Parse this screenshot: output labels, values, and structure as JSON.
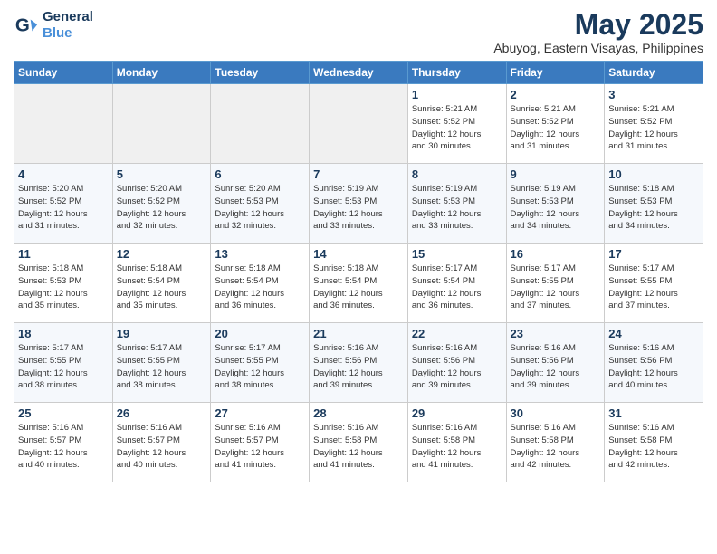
{
  "logo": {
    "line1": "General",
    "line2": "Blue"
  },
  "title": "May 2025",
  "subtitle": "Abuyog, Eastern Visayas, Philippines",
  "headers": [
    "Sunday",
    "Monday",
    "Tuesday",
    "Wednesday",
    "Thursday",
    "Friday",
    "Saturday"
  ],
  "weeks": [
    [
      {
        "day": "",
        "info": ""
      },
      {
        "day": "",
        "info": ""
      },
      {
        "day": "",
        "info": ""
      },
      {
        "day": "",
        "info": ""
      },
      {
        "day": "1",
        "info": "Sunrise: 5:21 AM\nSunset: 5:52 PM\nDaylight: 12 hours\nand 30 minutes."
      },
      {
        "day": "2",
        "info": "Sunrise: 5:21 AM\nSunset: 5:52 PM\nDaylight: 12 hours\nand 31 minutes."
      },
      {
        "day": "3",
        "info": "Sunrise: 5:21 AM\nSunset: 5:52 PM\nDaylight: 12 hours\nand 31 minutes."
      }
    ],
    [
      {
        "day": "4",
        "info": "Sunrise: 5:20 AM\nSunset: 5:52 PM\nDaylight: 12 hours\nand 31 minutes."
      },
      {
        "day": "5",
        "info": "Sunrise: 5:20 AM\nSunset: 5:52 PM\nDaylight: 12 hours\nand 32 minutes."
      },
      {
        "day": "6",
        "info": "Sunrise: 5:20 AM\nSunset: 5:53 PM\nDaylight: 12 hours\nand 32 minutes."
      },
      {
        "day": "7",
        "info": "Sunrise: 5:19 AM\nSunset: 5:53 PM\nDaylight: 12 hours\nand 33 minutes."
      },
      {
        "day": "8",
        "info": "Sunrise: 5:19 AM\nSunset: 5:53 PM\nDaylight: 12 hours\nand 33 minutes."
      },
      {
        "day": "9",
        "info": "Sunrise: 5:19 AM\nSunset: 5:53 PM\nDaylight: 12 hours\nand 34 minutes."
      },
      {
        "day": "10",
        "info": "Sunrise: 5:18 AM\nSunset: 5:53 PM\nDaylight: 12 hours\nand 34 minutes."
      }
    ],
    [
      {
        "day": "11",
        "info": "Sunrise: 5:18 AM\nSunset: 5:53 PM\nDaylight: 12 hours\nand 35 minutes."
      },
      {
        "day": "12",
        "info": "Sunrise: 5:18 AM\nSunset: 5:54 PM\nDaylight: 12 hours\nand 35 minutes."
      },
      {
        "day": "13",
        "info": "Sunrise: 5:18 AM\nSunset: 5:54 PM\nDaylight: 12 hours\nand 36 minutes."
      },
      {
        "day": "14",
        "info": "Sunrise: 5:18 AM\nSunset: 5:54 PM\nDaylight: 12 hours\nand 36 minutes."
      },
      {
        "day": "15",
        "info": "Sunrise: 5:17 AM\nSunset: 5:54 PM\nDaylight: 12 hours\nand 36 minutes."
      },
      {
        "day": "16",
        "info": "Sunrise: 5:17 AM\nSunset: 5:55 PM\nDaylight: 12 hours\nand 37 minutes."
      },
      {
        "day": "17",
        "info": "Sunrise: 5:17 AM\nSunset: 5:55 PM\nDaylight: 12 hours\nand 37 minutes."
      }
    ],
    [
      {
        "day": "18",
        "info": "Sunrise: 5:17 AM\nSunset: 5:55 PM\nDaylight: 12 hours\nand 38 minutes."
      },
      {
        "day": "19",
        "info": "Sunrise: 5:17 AM\nSunset: 5:55 PM\nDaylight: 12 hours\nand 38 minutes."
      },
      {
        "day": "20",
        "info": "Sunrise: 5:17 AM\nSunset: 5:55 PM\nDaylight: 12 hours\nand 38 minutes."
      },
      {
        "day": "21",
        "info": "Sunrise: 5:16 AM\nSunset: 5:56 PM\nDaylight: 12 hours\nand 39 minutes."
      },
      {
        "day": "22",
        "info": "Sunrise: 5:16 AM\nSunset: 5:56 PM\nDaylight: 12 hours\nand 39 minutes."
      },
      {
        "day": "23",
        "info": "Sunrise: 5:16 AM\nSunset: 5:56 PM\nDaylight: 12 hours\nand 39 minutes."
      },
      {
        "day": "24",
        "info": "Sunrise: 5:16 AM\nSunset: 5:56 PM\nDaylight: 12 hours\nand 40 minutes."
      }
    ],
    [
      {
        "day": "25",
        "info": "Sunrise: 5:16 AM\nSunset: 5:57 PM\nDaylight: 12 hours\nand 40 minutes."
      },
      {
        "day": "26",
        "info": "Sunrise: 5:16 AM\nSunset: 5:57 PM\nDaylight: 12 hours\nand 40 minutes."
      },
      {
        "day": "27",
        "info": "Sunrise: 5:16 AM\nSunset: 5:57 PM\nDaylight: 12 hours\nand 41 minutes."
      },
      {
        "day": "28",
        "info": "Sunrise: 5:16 AM\nSunset: 5:58 PM\nDaylight: 12 hours\nand 41 minutes."
      },
      {
        "day": "29",
        "info": "Sunrise: 5:16 AM\nSunset: 5:58 PM\nDaylight: 12 hours\nand 41 minutes."
      },
      {
        "day": "30",
        "info": "Sunrise: 5:16 AM\nSunset: 5:58 PM\nDaylight: 12 hours\nand 42 minutes."
      },
      {
        "day": "31",
        "info": "Sunrise: 5:16 AM\nSunset: 5:58 PM\nDaylight: 12 hours\nand 42 minutes."
      }
    ]
  ]
}
